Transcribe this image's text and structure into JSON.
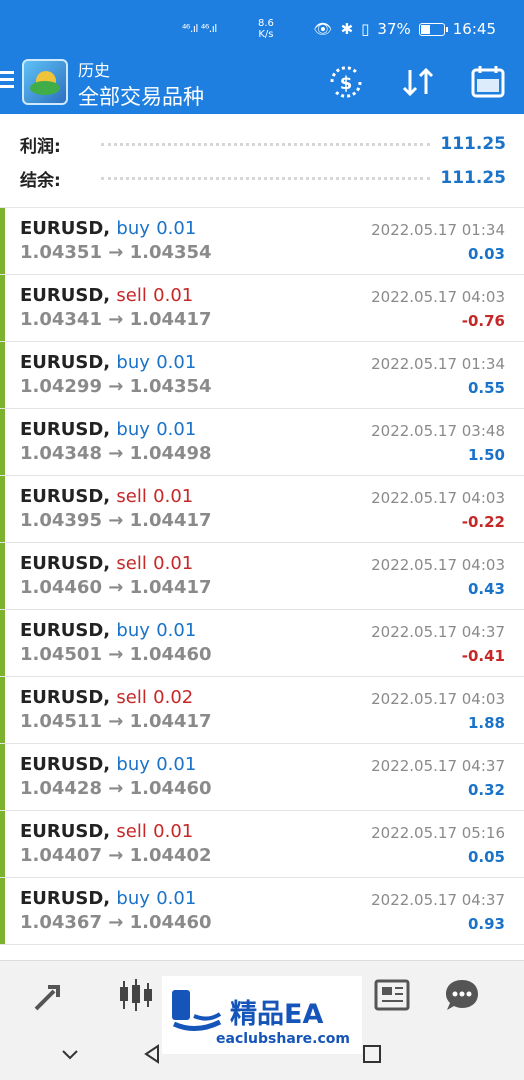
{
  "status_bar": {
    "network": "⁴⁶.ıl ⁴⁶.ıl",
    "speed_value": "8.6",
    "speed_unit": "K/s",
    "battery": "37%",
    "time": "16:45"
  },
  "app_bar": {
    "title_small": "历史",
    "title_big": "全部交易品种",
    "icons": [
      "menu-icon",
      "app-logo",
      "currency-exchange-icon",
      "sort-icon",
      "calendar-icon"
    ]
  },
  "summary": {
    "profit_label": "利润:",
    "profit_value": "111.25",
    "balance_label": "结余:",
    "balance_value": "111.25"
  },
  "trades": [
    {
      "symbol": "EURUSD,",
      "side": "buy",
      "volume": "0.01",
      "prices": "1.04351 → 1.04354",
      "time": "2022.05.17 01:34",
      "profit": "0.03"
    },
    {
      "symbol": "EURUSD,",
      "side": "sell",
      "volume": "0.01",
      "prices": "1.04341 → 1.04417",
      "time": "2022.05.17 04:03",
      "profit": "-0.76"
    },
    {
      "symbol": "EURUSD,",
      "side": "buy",
      "volume": "0.01",
      "prices": "1.04299 → 1.04354",
      "time": "2022.05.17 01:34",
      "profit": "0.55"
    },
    {
      "symbol": "EURUSD,",
      "side": "buy",
      "volume": "0.01",
      "prices": "1.04348 → 1.04498",
      "time": "2022.05.17 03:48",
      "profit": "1.50"
    },
    {
      "symbol": "EURUSD,",
      "side": "sell",
      "volume": "0.01",
      "prices": "1.04395 → 1.04417",
      "time": "2022.05.17 04:03",
      "profit": "-0.22"
    },
    {
      "symbol": "EURUSD,",
      "side": "sell",
      "volume": "0.01",
      "prices": "1.04460 → 1.04417",
      "time": "2022.05.17 04:03",
      "profit": "0.43"
    },
    {
      "symbol": "EURUSD,",
      "side": "buy",
      "volume": "0.01",
      "prices": "1.04501 → 1.04460",
      "time": "2022.05.17 04:37",
      "profit": "-0.41"
    },
    {
      "symbol": "EURUSD,",
      "side": "sell",
      "volume": "0.02",
      "prices": "1.04511 → 1.04417",
      "time": "2022.05.17 04:03",
      "profit": "1.88"
    },
    {
      "symbol": "EURUSD,",
      "side": "buy",
      "volume": "0.01",
      "prices": "1.04428 → 1.04460",
      "time": "2022.05.17 04:37",
      "profit": "0.32"
    },
    {
      "symbol": "EURUSD,",
      "side": "sell",
      "volume": "0.01",
      "prices": "1.04407 → 1.04402",
      "time": "2022.05.17 05:16",
      "profit": "0.05"
    },
    {
      "symbol": "EURUSD,",
      "side": "buy",
      "volume": "0.01",
      "prices": "1.04367 → 1.04460",
      "time": "2022.05.17 04:37",
      "profit": "0.93"
    }
  ],
  "bottom_nav": [
    "quotes-icon",
    "chart-icon",
    "trade-icon",
    "news-icon",
    "chat-icon"
  ],
  "watermark": {
    "text": "精品EA",
    "url": "eaclubshare.com"
  },
  "colors": {
    "primary": "#1e7fe0",
    "buy": "#1a73c8",
    "sell": "#c62828",
    "row_bar": "#7bb32e"
  }
}
